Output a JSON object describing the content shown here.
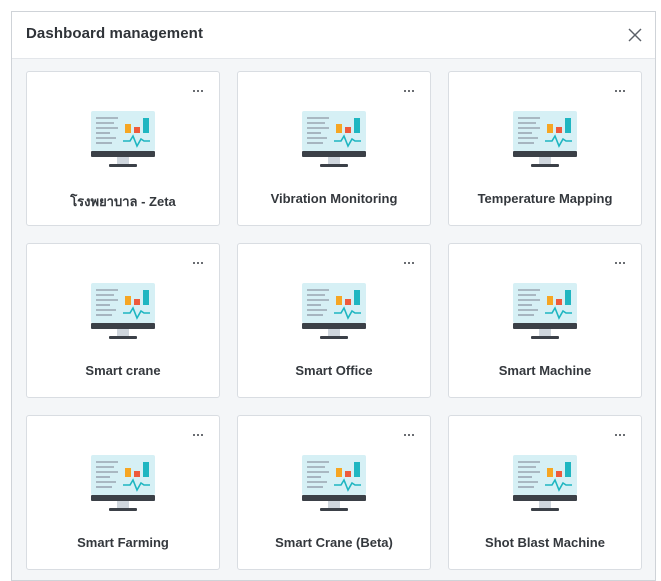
{
  "modal": {
    "title": "Dashboard management",
    "close_icon": "close-icon"
  },
  "cards": [
    {
      "label": "โรงพยาบาล - Zeta",
      "icon": "dashboard-monitor-icon",
      "menu_icon": "more-horizontal-icon"
    },
    {
      "label": "Vibration Monitoring",
      "icon": "dashboard-monitor-icon",
      "menu_icon": "more-horizontal-icon"
    },
    {
      "label": "Temperature Mapping",
      "icon": "dashboard-monitor-icon",
      "menu_icon": "more-horizontal-icon"
    },
    {
      "label": "Smart crane",
      "icon": "dashboard-monitor-icon",
      "menu_icon": "more-horizontal-icon"
    },
    {
      "label": "Smart Office",
      "icon": "dashboard-monitor-icon",
      "menu_icon": "more-horizontal-icon"
    },
    {
      "label": "Smart Machine",
      "icon": "dashboard-monitor-icon",
      "menu_icon": "more-horizontal-icon"
    },
    {
      "label": "Smart Farming",
      "icon": "dashboard-monitor-icon",
      "menu_icon": "more-horizontal-icon"
    },
    {
      "label": "Smart Crane (Beta)",
      "icon": "dashboard-monitor-icon",
      "menu_icon": "more-horizontal-icon"
    },
    {
      "label": "Shot Blast Machine",
      "icon": "dashboard-monitor-icon",
      "menu_icon": "more-horizontal-icon"
    }
  ],
  "colors": {
    "screen": "#d6f0f5",
    "bezel": "#3b4047",
    "bar_orange": "#f6a623",
    "bar_red": "#ee5a3c",
    "bar_teal": "#1fb6c1",
    "pulse": "#1fb6c1",
    "lines": "#9aa6b2"
  }
}
